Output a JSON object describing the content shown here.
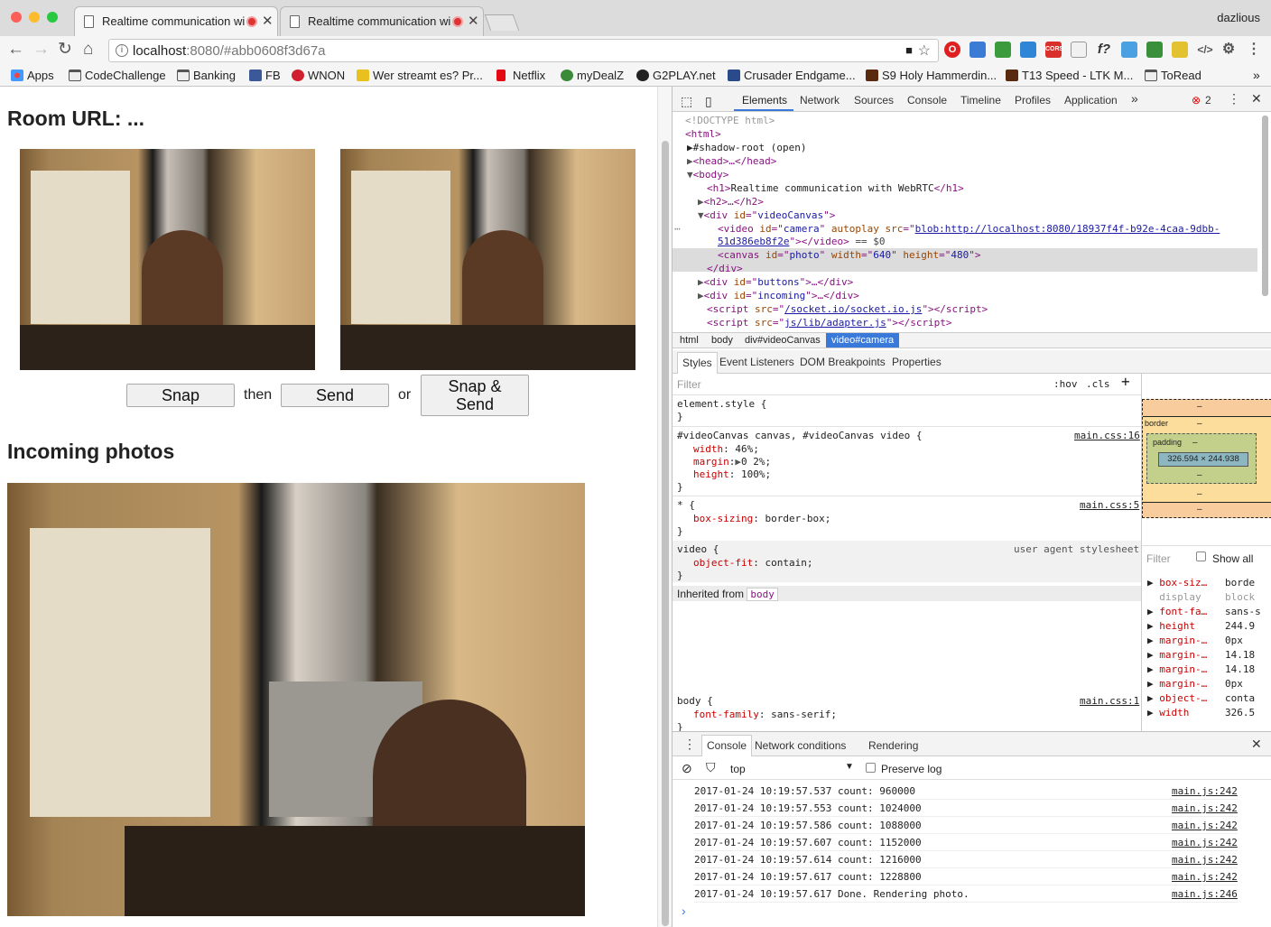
{
  "browser": {
    "tabs": [
      {
        "title": "Realtime communication wi"
      },
      {
        "title": "Realtime communication wi"
      }
    ],
    "profile": "dazlious",
    "url_host": "localhost",
    "url_path": ":8080/#abb0608f3d67a",
    "bookmarks": [
      {
        "label": "Apps"
      },
      {
        "label": "CodeChallenge"
      },
      {
        "label": "Banking"
      },
      {
        "label": "FB"
      },
      {
        "label": "WNON"
      },
      {
        "label": "Wer streamt es? Pr..."
      },
      {
        "label": "Netflix"
      },
      {
        "label": "myDealZ"
      },
      {
        "label": "G2PLAY.net"
      },
      {
        "label": "Crusader Endgame..."
      },
      {
        "label": "S9 Holy Hammerdin..."
      },
      {
        "label": "T13 Speed - LTK M..."
      },
      {
        "label": "ToRead"
      }
    ]
  },
  "page": {
    "room_heading": "Room URL: ...",
    "btn_snap": "Snap",
    "text_then": "then",
    "btn_send": "Send",
    "text_or": "or",
    "btn_snap_send_line1": "Snap &",
    "btn_snap_send_line2": "Send",
    "incoming_heading": "Incoming photos"
  },
  "devtools": {
    "tabs": [
      "Elements",
      "Network",
      "Sources",
      "Console",
      "Timeline",
      "Profiles",
      "Application"
    ],
    "error_count": "2",
    "dom": {
      "doctype": "<!DOCTYPE html>",
      "html": "<html>",
      "shadow": "#shadow-root (open)",
      "head": "<head>…</head>",
      "body": "<body>",
      "h1_open": "<h1>",
      "h1_text": "Realtime communication with WebRTC",
      "h1_close": "</h1>",
      "h2": "<h2>…</h2>",
      "videocanvas": "videoCanvas",
      "video_id": "camera",
      "video_src1": "blob:http://localhost:8080/18937f4f-b92e-4caa-9dbb-",
      "video_src2": "51d386eb8f2e",
      "video_eq": "== $0",
      "canvas_id": "photo",
      "canvas_w": "640",
      "canvas_h": "480",
      "div_close": "</div>",
      "buttons": "buttons",
      "incoming": "incoming",
      "script1": "/socket.io/socket.io.js",
      "script2": "js/lib/adapter.js"
    },
    "breadcrumbs": [
      "html",
      "body",
      "div#videoCanvas",
      "video#camera"
    ],
    "subtabs": [
      "Styles",
      "Event Listeners",
      "DOM Breakpoints",
      "Properties"
    ],
    "filter_placeholder": "Filter",
    "hov": ":hov",
    "cls": ".cls",
    "styles": {
      "element_style": "element.style {",
      "rule1_selector": "#videoCanvas canvas, #videoCanvas video {",
      "rule1_src": "main.css:16",
      "rule1_props": [
        {
          "name": "width",
          "value": "46%;"
        },
        {
          "name": "margin",
          "value": "0 2%;"
        },
        {
          "name": "height",
          "value": "100%;"
        }
      ],
      "rule2_selector": "* {",
      "rule2_src": "main.css:5",
      "rule2_prop": "box-sizing",
      "rule2_val": "border-box;",
      "rule3_selector": "video {",
      "rule3_src": "user agent stylesheet",
      "rule3_prop": "object-fit",
      "rule3_val": "contain;",
      "inherited_label": "Inherited from",
      "inherited_tag": "body",
      "rule4_selector": "body {",
      "rule4_src": "main.css:1",
      "rule4_prop": "font-family",
      "rule4_val": "sans-serif;",
      "close_brace": "}"
    },
    "boxmodel": {
      "border_label": "border",
      "padding_label": "padding",
      "dash": "–",
      "content_size": "326.594 × 244.938"
    },
    "computed": {
      "filter": "Filter",
      "show_all": "Show all",
      "rows": [
        {
          "name": "box-siz…",
          "value": "borde"
        },
        {
          "name": "display",
          "value": "block"
        },
        {
          "name": "font-fa…",
          "value": "sans-s"
        },
        {
          "name": "height",
          "value": "244.9"
        },
        {
          "name": "margin-…",
          "value": "0px"
        },
        {
          "name": "margin-…",
          "value": "14.18"
        },
        {
          "name": "margin-…",
          "value": "14.18"
        },
        {
          "name": "margin-…",
          "value": "0px"
        },
        {
          "name": "object-…",
          "value": "conta"
        },
        {
          "name": "width",
          "value": "326.5"
        }
      ]
    },
    "drawer": {
      "tabs": [
        "Console",
        "Network conditions",
        "Rendering"
      ],
      "context": "top",
      "preserve_log": "Preserve log",
      "logs": [
        {
          "text": "2017-01-24 10:19:57.537 count: 960000",
          "src": "main.js:242"
        },
        {
          "text": "2017-01-24 10:19:57.553 count: 1024000",
          "src": "main.js:242"
        },
        {
          "text": "2017-01-24 10:19:57.586 count: 1088000",
          "src": "main.js:242"
        },
        {
          "text": "2017-01-24 10:19:57.607 count: 1152000",
          "src": "main.js:242"
        },
        {
          "text": "2017-01-24 10:19:57.614 count: 1216000",
          "src": "main.js:242"
        },
        {
          "text": "2017-01-24 10:19:57.617 count: 1228800",
          "src": "main.js:242"
        },
        {
          "text": "2017-01-24 10:19:57.617 Done. Rendering photo.",
          "src": "main.js:246"
        }
      ],
      "prompt": "›"
    }
  }
}
